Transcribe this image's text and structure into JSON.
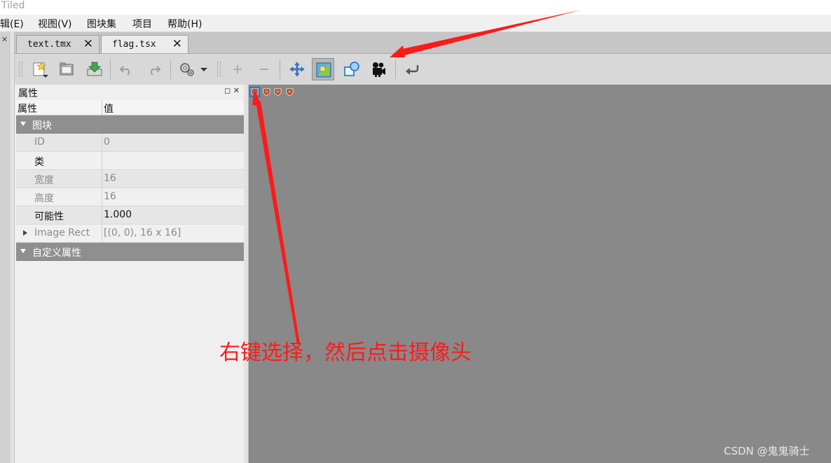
{
  "window": {
    "title": "Tiled"
  },
  "menu": [
    "辑(E)",
    "视图(V)",
    "图块集",
    "项目",
    "帮助(H)"
  ],
  "tabs": [
    {
      "label": "text.tmx",
      "close": "✕"
    },
    {
      "label": "flag.tsx",
      "close": "✕"
    }
  ],
  "toolbar": {
    "icons": [
      "new-tileset-icon",
      "open-file-icon",
      "save-export-icon",
      "undo-icon",
      "redo-icon",
      "tileset-properties-icon",
      "dropdown-arrow-icon",
      "add-tiles-icon",
      "remove-tiles-icon",
      "move-icon",
      "tile-edit-icon",
      "collision-editor-icon",
      "animation-editor-icon",
      "back-icon"
    ]
  },
  "properties_panel": {
    "title": "属性",
    "columns": [
      "属性",
      "值"
    ],
    "group_tile": "图块",
    "rows": [
      {
        "name": "ID",
        "value": "0"
      },
      {
        "name": "类",
        "value": ""
      },
      {
        "name": "宽度",
        "value": "16"
      },
      {
        "name": "高度",
        "value": "16"
      },
      {
        "name": "可能性",
        "value": "1.000"
      },
      {
        "name": "Image Rect",
        "value": "[(0, 0), 16 x 16]"
      }
    ],
    "group_custom": "自定义属性"
  },
  "tileset": {
    "tile_count": 4
  },
  "annotation": "右键选择，然后点击摄像头",
  "watermark": "CSDN @鬼鬼骑士",
  "colors": {
    "annotation": "#ff1a1a",
    "canvas": "#898989",
    "group_header": "#8f8f8f"
  }
}
